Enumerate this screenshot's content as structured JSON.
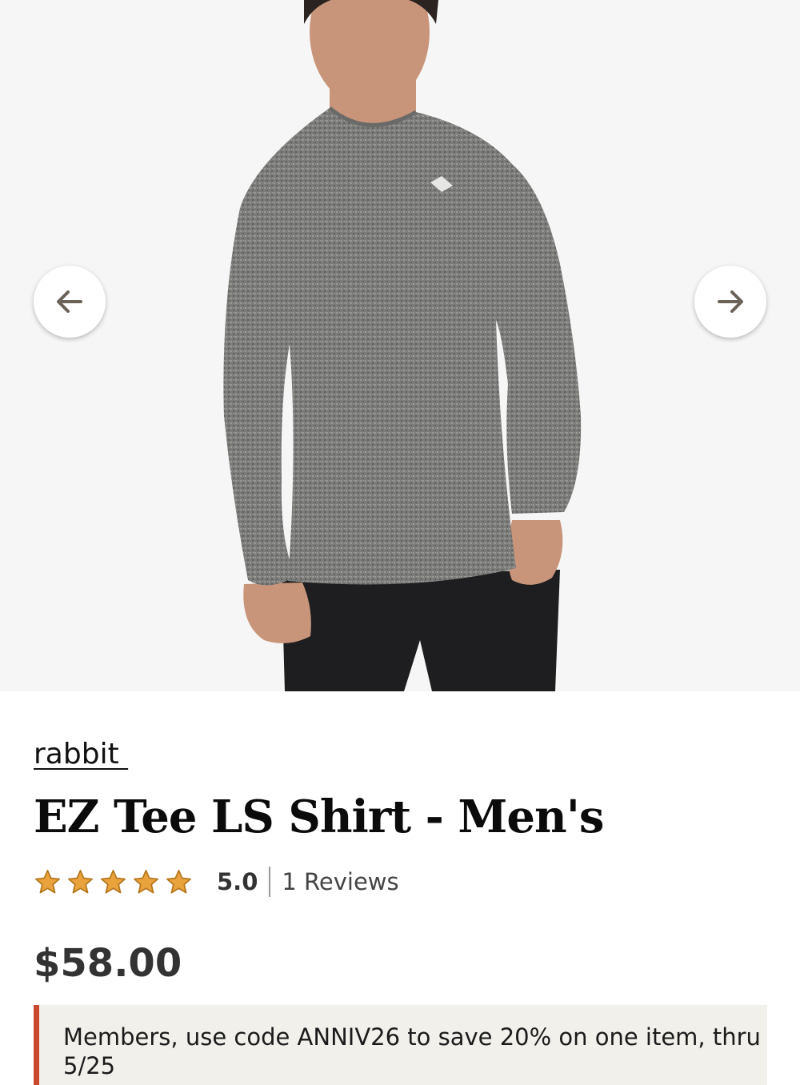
{
  "gallery": {
    "image_alt": "Man wearing heather gray long sleeve shirt and black shorts",
    "prev_icon": "arrow-left-icon",
    "next_icon": "arrow-right-icon"
  },
  "product": {
    "brand": "rabbit ",
    "title": "EZ Tee LS Shirt - Men's",
    "rating": {
      "stars": 5,
      "max_stars": 5,
      "value": "5.0",
      "reviews_label": "1 Reviews",
      "star_color": "#e8a33d"
    },
    "price": "$58.00"
  },
  "promo": {
    "text": "Members, use code ANNIV26 to save 20% on one item, thru 5/25",
    "accent_color": "#c8492b"
  }
}
